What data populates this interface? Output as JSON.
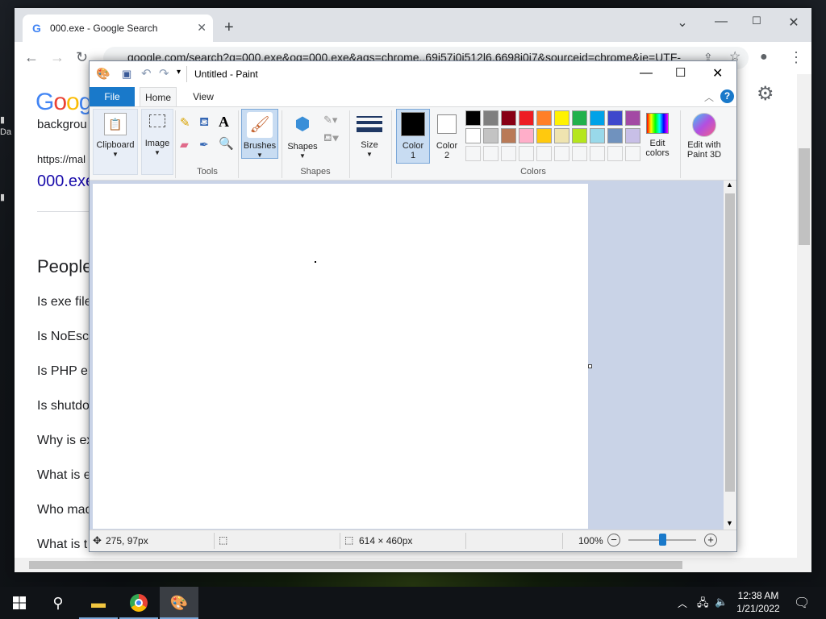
{
  "chrome": {
    "tab_title": "000.exe - Google Search",
    "url": "google.com/search?q=000.exe&oq=000.exe&aqs=chrome..69i57j0i512l6.6698j0j7&sourceid=chrome&ie=UTF-",
    "logo": "Goog",
    "page": {
      "line1": "backgrou",
      "link_url": "https://mal",
      "link_title": "000.exe",
      "people_heading": "People",
      "questions": [
        "Is exe file",
        "Is NoEsc",
        "Is PHP e",
        "Is shutdo",
        "Why is ex",
        "What is e",
        "Who mad",
        "What is t"
      ]
    }
  },
  "desktop": {
    "label_fragment": "Da"
  },
  "paint": {
    "title": "Untitled - Paint",
    "tabs": {
      "file": "File",
      "home": "Home",
      "view": "View"
    },
    "groups": {
      "clipboard": "Clipboard",
      "image": "Image",
      "tools": "Tools",
      "brushes": "Brushes",
      "shapes_btn": "Shapes",
      "shapes": "Shapes",
      "size": "Size",
      "color1": "Color",
      "color1_num": "1",
      "color2": "Color",
      "color2_num": "2",
      "edit_colors_1": "Edit",
      "edit_colors_2": "colors",
      "paint3d_1": "Edit with",
      "paint3d_2": "Paint 3D",
      "colors": "Colors"
    },
    "palette_row1": [
      "#000000",
      "#7f7f7f",
      "#880015",
      "#ed1c24",
      "#ff7f27",
      "#fff200",
      "#22b14c",
      "#00a2e8",
      "#3f48cc",
      "#a349a4"
    ],
    "palette_row2": [
      "#ffffff",
      "#c3c3c3",
      "#b97a57",
      "#ffaec9",
      "#ffc90e",
      "#efe4b0",
      "#b5e61d",
      "#99d9ea",
      "#7092be",
      "#c8bfe7"
    ],
    "status": {
      "cursor_pos": "275, 97px",
      "canvas_size": "614 × 460px",
      "zoom": "100%"
    }
  },
  "taskbar": {
    "time": "12:38 AM",
    "date": "1/21/2022"
  }
}
